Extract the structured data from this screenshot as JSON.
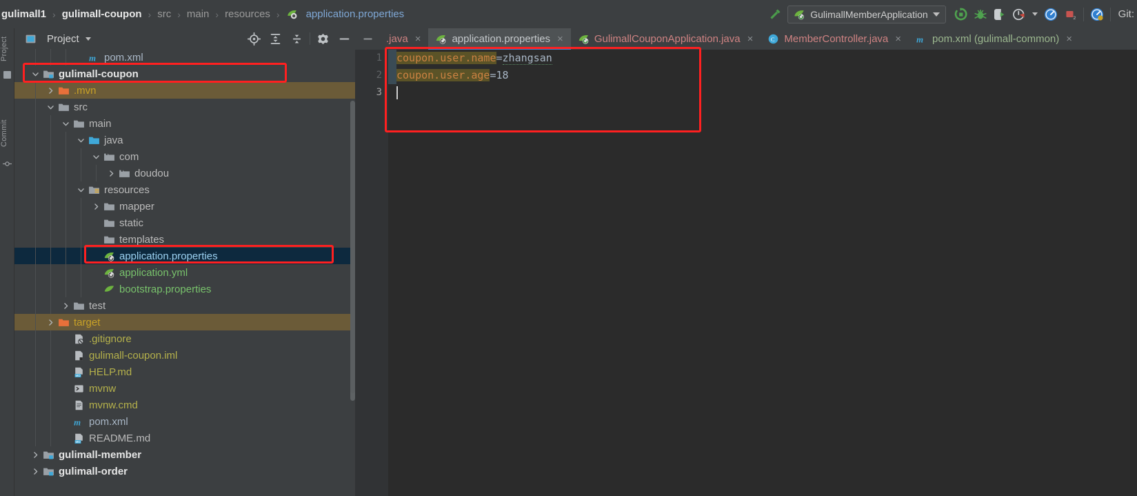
{
  "breadcrumb": {
    "items": [
      {
        "label": "gulimall1",
        "style": "bold"
      },
      {
        "label": "gulimall-coupon",
        "style": "bold"
      },
      {
        "label": "src",
        "style": "dim"
      },
      {
        "label": "main",
        "style": "dim"
      },
      {
        "label": "resources",
        "style": "dim"
      },
      {
        "label": "application.properties",
        "style": "linkish",
        "icon": "spring-properties-icon"
      }
    ],
    "separator": "›"
  },
  "toolbar": {
    "build_icon": "hammer-icon",
    "run_config": {
      "label": "GulimallMemberApplication",
      "icon": "spring-boot-icon",
      "caret": "chevron-down-icon"
    },
    "actions": [
      {
        "name": "run-button",
        "icon": "run-icon"
      },
      {
        "name": "debug-button",
        "icon": "debug-bug-icon"
      },
      {
        "name": "run-with-coverage-button",
        "icon": "coverage-icon"
      },
      {
        "name": "profiler-button",
        "icon": "profiler-icon"
      },
      {
        "name": "profiler-dropdown",
        "icon": "chevron-down-icon"
      },
      {
        "name": "services-button",
        "icon": "dashboard-icon"
      },
      {
        "name": "stop-button",
        "icon": "stop-square-icon"
      },
      {
        "name": "search-everywhere-button",
        "icon": "dashboard-search-icon"
      }
    ],
    "git_label": "Git:"
  },
  "left_strip": {
    "project_label": "Project",
    "commit_label": "Commit"
  },
  "project_panel": {
    "title": "Project",
    "title_caret": "chevron-down-icon",
    "actions": [
      {
        "name": "select-opened-file-button",
        "icon": "crosshair-target-icon"
      },
      {
        "name": "expand-all-button",
        "icon": "expand-all-icon"
      },
      {
        "name": "collapse-all-button",
        "icon": "collapse-all-icon"
      },
      {
        "name": "settings-button",
        "icon": "gear-icon"
      },
      {
        "name": "hide-button",
        "icon": "minus-icon"
      }
    ],
    "tree": [
      {
        "label": "pom.xml",
        "indent": 4,
        "twist": "none",
        "icon": "maven-xml-icon",
        "style": "xml"
      },
      {
        "label": "gulimall-coupon",
        "indent": 1,
        "twist": "open",
        "icon": "module-folder-icon",
        "style": "bold"
      },
      {
        "label": ".mvn",
        "indent": 2,
        "twist": "closed",
        "icon": "excluded-folder-icon",
        "style": "orange",
        "row": "excluded"
      },
      {
        "label": "src",
        "indent": 2,
        "twist": "open",
        "icon": "folder-icon",
        "style": "plain"
      },
      {
        "label": "main",
        "indent": 3,
        "twist": "open",
        "icon": "folder-icon",
        "style": "plain"
      },
      {
        "label": "java",
        "indent": 4,
        "twist": "open",
        "icon": "source-folder-icon",
        "style": "plain"
      },
      {
        "label": "com",
        "indent": 5,
        "twist": "open",
        "icon": "package-icon",
        "style": "plain"
      },
      {
        "label": "doudou",
        "indent": 6,
        "twist": "closed",
        "icon": "package-icon",
        "style": "plain"
      },
      {
        "label": "resources",
        "indent": 4,
        "twist": "open",
        "icon": "resource-folder-icon",
        "style": "plain"
      },
      {
        "label": "mapper",
        "indent": 5,
        "twist": "closed",
        "icon": "folder-icon",
        "style": "plain"
      },
      {
        "label": "static",
        "indent": 5,
        "twist": "none",
        "icon": "folder-icon",
        "style": "plain"
      },
      {
        "label": "templates",
        "indent": 5,
        "twist": "none",
        "icon": "folder-icon",
        "style": "plain"
      },
      {
        "label": "application.properties",
        "indent": 5,
        "twist": "none",
        "icon": "spring-properties-icon",
        "style": "selected",
        "row": "selected"
      },
      {
        "label": "application.yml",
        "indent": 5,
        "twist": "none",
        "icon": "spring-properties-icon",
        "style": "green"
      },
      {
        "label": "bootstrap.properties",
        "indent": 5,
        "twist": "none",
        "icon": "properties-icon",
        "style": "green"
      },
      {
        "label": "test",
        "indent": 3,
        "twist": "closed",
        "icon": "folder-icon",
        "style": "plain"
      },
      {
        "label": "target",
        "indent": 2,
        "twist": "closed",
        "icon": "excluded-folder-icon",
        "style": "orange",
        "row": "excluded"
      },
      {
        "label": ".gitignore",
        "indent": 3,
        "twist": "none",
        "icon": "gitignore-icon",
        "style": "yellow"
      },
      {
        "label": "gulimall-coupon.iml",
        "indent": 3,
        "twist": "none",
        "icon": "iml-icon",
        "style": "yellow"
      },
      {
        "label": "HELP.md",
        "indent": 3,
        "twist": "none",
        "icon": "markdown-icon",
        "style": "yellow"
      },
      {
        "label": "mvnw",
        "indent": 3,
        "twist": "none",
        "icon": "shell-script-icon",
        "style": "yellow"
      },
      {
        "label": "mvnw.cmd",
        "indent": 3,
        "twist": "none",
        "icon": "cmd-file-icon",
        "style": "yellow"
      },
      {
        "label": "pom.xml",
        "indent": 3,
        "twist": "none",
        "icon": "maven-xml-icon",
        "style": "xml"
      },
      {
        "label": "README.md",
        "indent": 3,
        "twist": "none",
        "icon": "markdown-icon",
        "style": "plain"
      },
      {
        "label": "gulimall-member",
        "indent": 1,
        "twist": "closed",
        "icon": "module-folder-icon",
        "style": "bold"
      },
      {
        "label": "gulimall-order",
        "indent": 1,
        "twist": "closed",
        "icon": "module-folder-icon",
        "style": "bold"
      }
    ]
  },
  "editor": {
    "collapse_icon": "minus-icon",
    "tabs": [
      {
        "label": ".java",
        "style": "red",
        "icon": "none",
        "active": false,
        "close": "×"
      },
      {
        "label": "application.properties",
        "style": "white",
        "icon": "spring-properties-icon",
        "active": true,
        "close": "×"
      },
      {
        "label": "GulimallCouponApplication.java",
        "style": "red",
        "icon": "spring-boot-icon",
        "active": false,
        "close": "×"
      },
      {
        "label": "MemberController.java",
        "style": "red",
        "icon": "java-class-icon",
        "active": false,
        "close": "×"
      },
      {
        "label": "pom.xml (gulimall-common)",
        "style": "green",
        "icon": "maven-xml-icon",
        "active": false,
        "close": "×"
      }
    ],
    "line_numbers": [
      "1",
      "2",
      "3"
    ],
    "current_line": "3",
    "lines": [
      {
        "key": "coupon.user.name",
        "sep": "=",
        "value": "zhangsan",
        "value_kind": "string"
      },
      {
        "key": "coupon.user.age",
        "sep": "=",
        "value": "18",
        "value_kind": "number"
      },
      {
        "key": "",
        "sep": "",
        "value": "",
        "value_kind": "empty"
      }
    ]
  },
  "colors": {
    "panel_bg": "#3C3F41",
    "editor_bg": "#2B2B2B",
    "gutter_bg": "#313335",
    "selection_blue": "#0D293E",
    "excluded_amber": "#6B5B38",
    "annotation_red": "#FF2020",
    "tab_active_bg": "#4E5254",
    "tab_underline": "#3B87D3",
    "key_fg": "#CC8242",
    "key_bg": "#5B5327",
    "value_fg": "#A9B7C6"
  }
}
